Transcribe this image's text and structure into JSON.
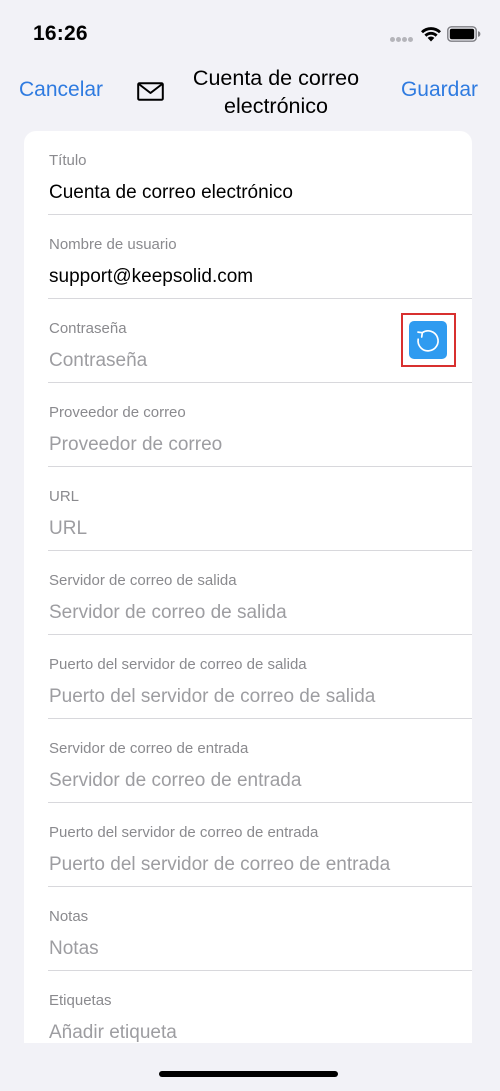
{
  "status_bar": {
    "time": "16:26"
  },
  "nav": {
    "cancel_label": "Cancelar",
    "title": "Cuenta de correo electrónico",
    "save_label": "Guardar"
  },
  "fields": [
    {
      "label": "Título",
      "value": "Cuenta de correo electrónico",
      "placeholder": ""
    },
    {
      "label": "Nombre de usuario",
      "value": "support@keepsolid.com",
      "placeholder": ""
    },
    {
      "label": "Contraseña",
      "value": "",
      "placeholder": "Contraseña"
    },
    {
      "label": "Proveedor de correo",
      "value": "",
      "placeholder": "Proveedor de correo"
    },
    {
      "label": "URL",
      "value": "",
      "placeholder": "URL"
    },
    {
      "label": "Servidor de correo de salida",
      "value": "",
      "placeholder": "Servidor de correo de salida"
    },
    {
      "label": "Puerto del servidor de correo de salida",
      "value": "",
      "placeholder": "Puerto del servidor de correo de salida"
    },
    {
      "label": "Servidor de correo de entrada",
      "value": "",
      "placeholder": "Servidor de correo de entrada"
    },
    {
      "label": "Puerto del servidor de correo de entrada",
      "value": "",
      "placeholder": "Puerto del servidor de correo de entrada"
    },
    {
      "label": "Notas",
      "value": "",
      "placeholder": "Notas"
    },
    {
      "label": "Etiquetas",
      "value": "",
      "placeholder": "Añadir etiqueta"
    }
  ],
  "icons": {
    "envelope": "envelope-icon",
    "refresh": "refresh-icon",
    "wifi": "wifi-icon",
    "battery": "battery-icon"
  },
  "colors": {
    "accent": "#2f7be0",
    "refresh_button": "#2f9bf0",
    "highlight": "#d8302f",
    "background": "#f2f2f7"
  }
}
